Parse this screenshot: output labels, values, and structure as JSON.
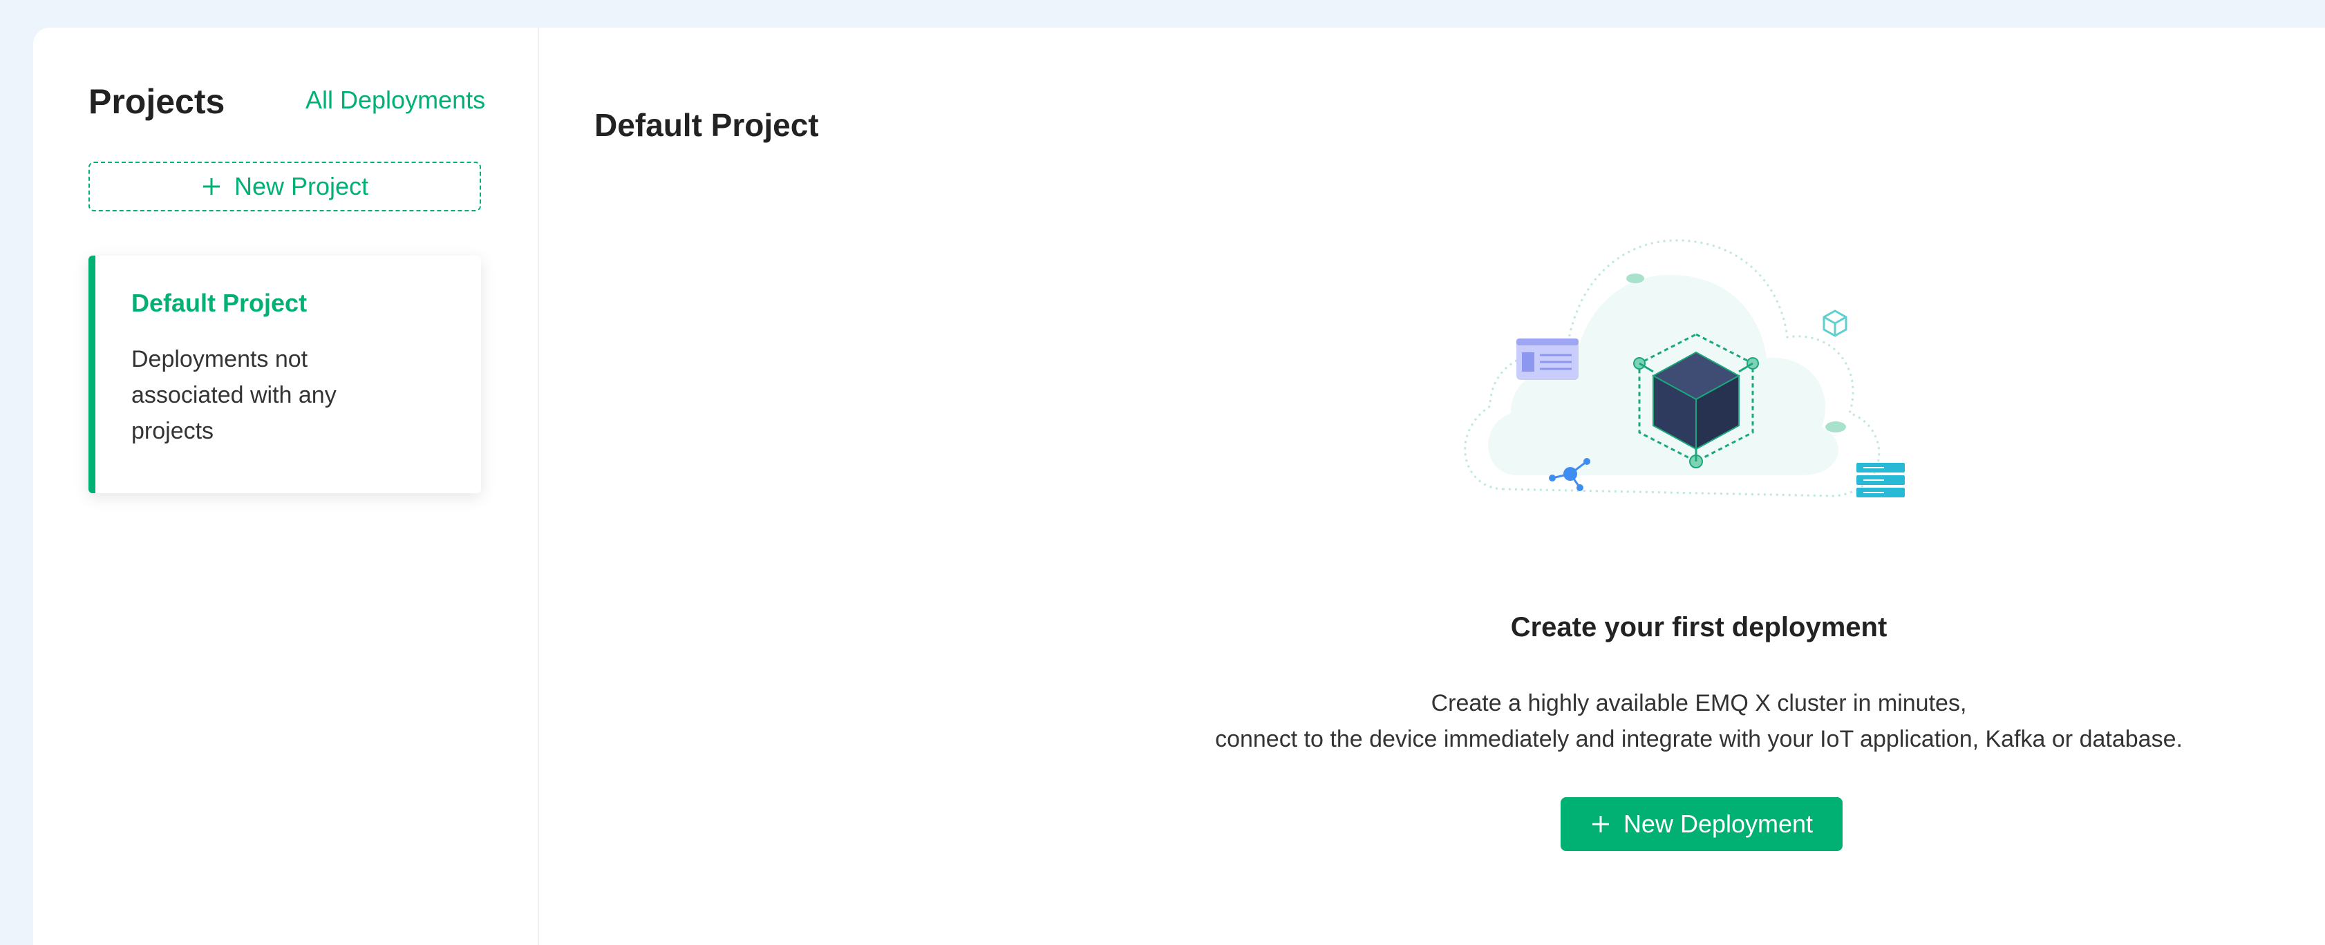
{
  "sidebar": {
    "title": "Projects",
    "all_deployments_link": "All Deployments",
    "new_project_label": "New Project",
    "project_card": {
      "name": "Default Project",
      "description": "Deployments not associated with any projects"
    }
  },
  "main": {
    "title": "Default Project",
    "empty_state": {
      "title": "Create your first deployment",
      "description_line1": "Create a highly available EMQ X cluster in minutes,",
      "description_line2": "connect to the device immediately and integrate with your IoT application, Kafka or database.",
      "button_label": "New Deployment"
    }
  },
  "colors": {
    "accent": "#00b173",
    "page_background": "#edf4fb",
    "card_background": "#ffffff",
    "text_primary": "#222222"
  },
  "icons": {
    "plus": "plus-icon",
    "illustration": "cloud-cube-illustration"
  }
}
